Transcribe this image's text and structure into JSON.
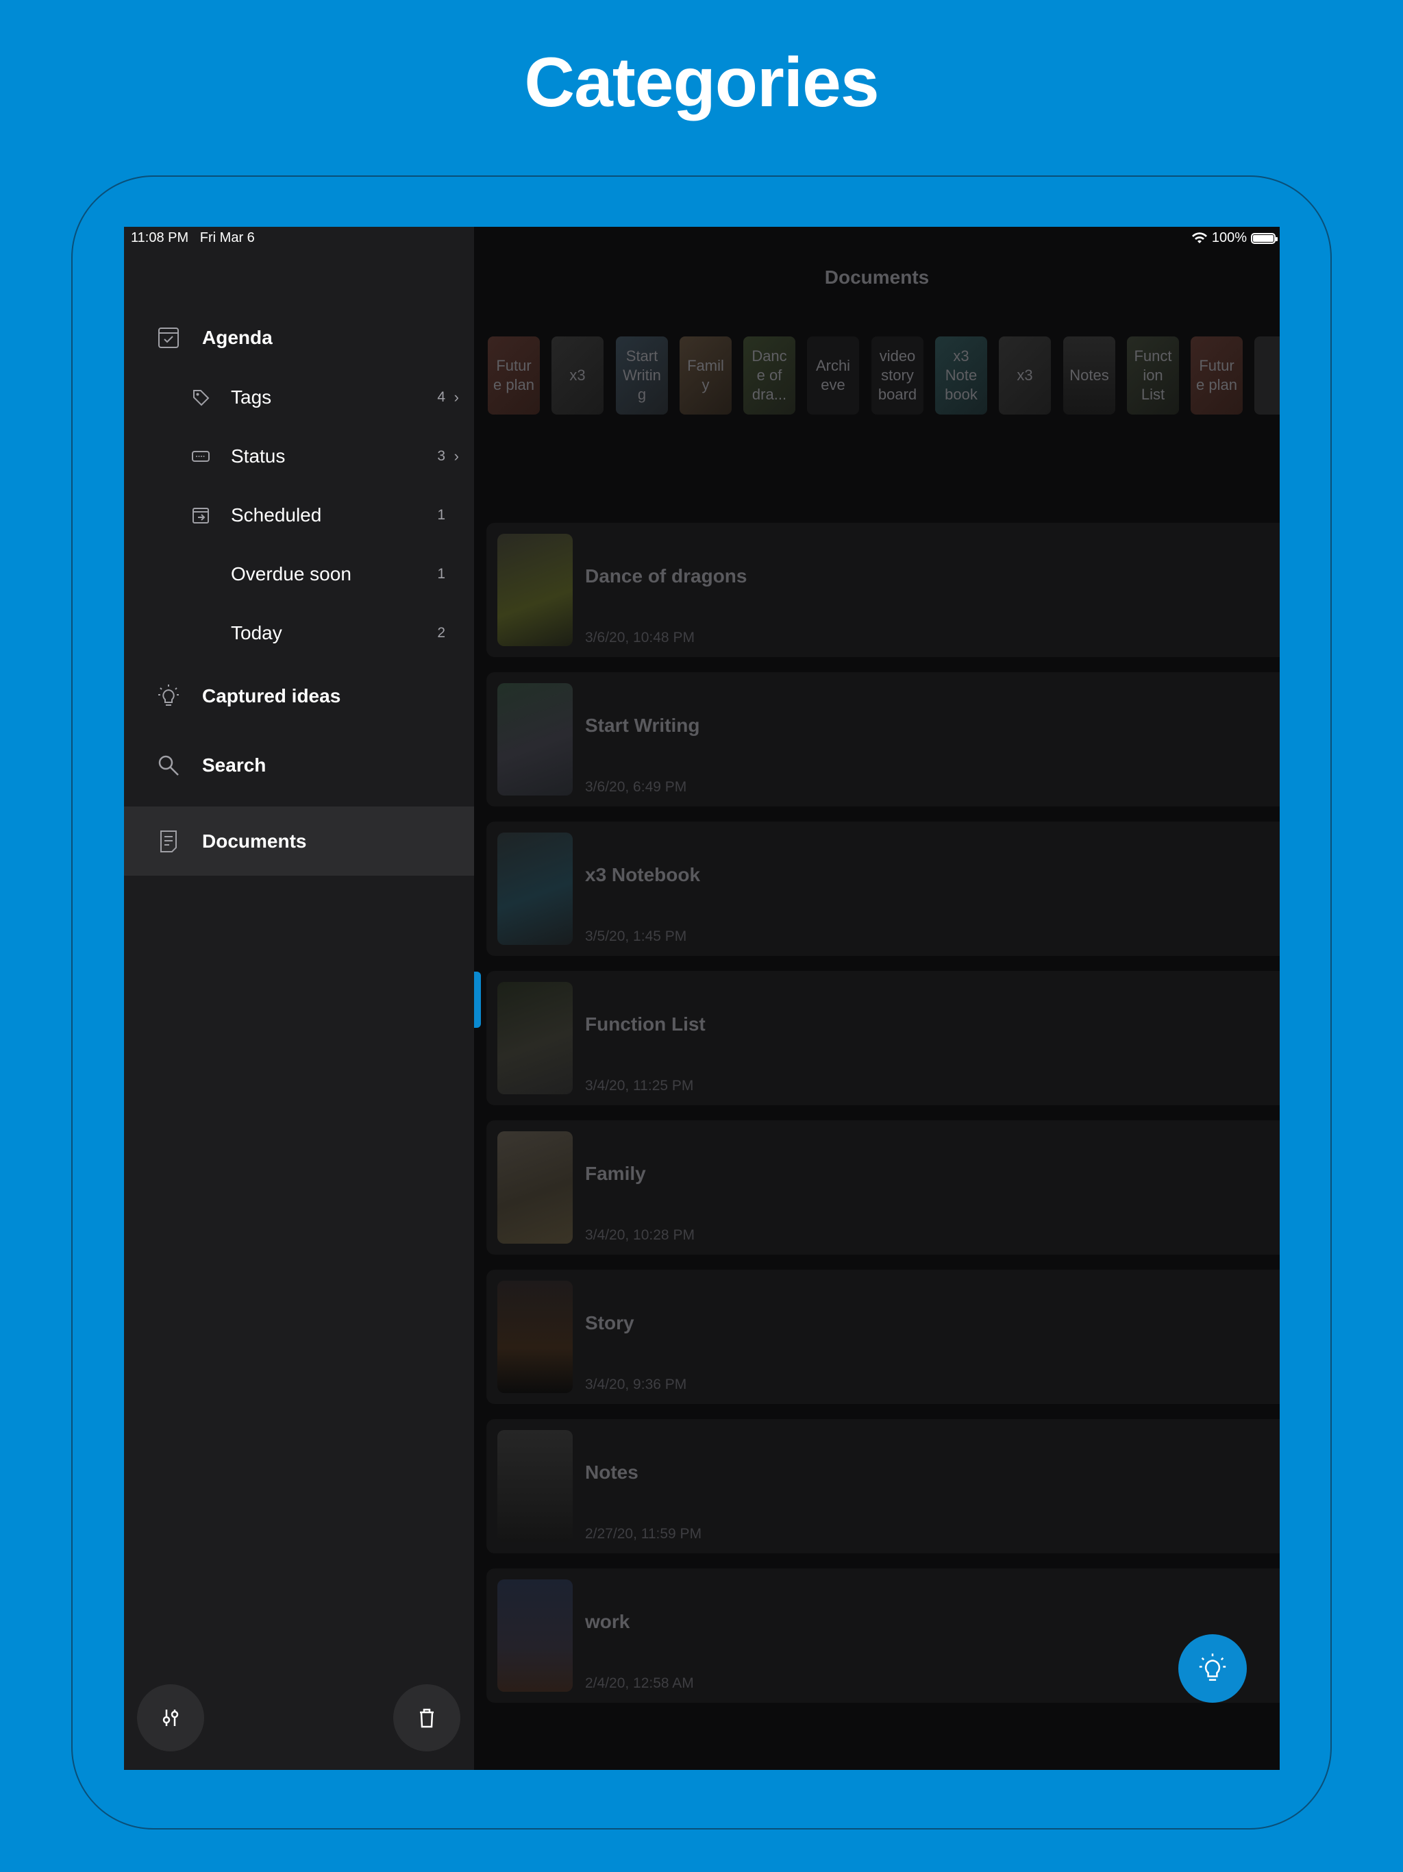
{
  "headline": "Categories",
  "status_bar": {
    "time": "11:08 PM",
    "date": "Fri Mar 6",
    "battery": "100%"
  },
  "sidebar": {
    "agenda": "Agenda",
    "tags": {
      "label": "Tags",
      "count": "4"
    },
    "status": {
      "label": "Status",
      "count": "3"
    },
    "scheduled": {
      "label": "Scheduled",
      "count": "1"
    },
    "overdue": {
      "label": "Overdue soon",
      "count": "1"
    },
    "today": {
      "label": "Today",
      "count": "2"
    },
    "captured": "Captured ideas",
    "search": "Search",
    "documents": "Documents"
  },
  "main": {
    "title": "Documents",
    "strip": [
      "Futur e plan",
      "x3",
      "Start Writin g",
      "Famil y",
      "Danc e of dra...",
      "Archi eve",
      "video story board",
      "x3 Note book",
      "x3",
      "Notes",
      "Funct ion List",
      "Futur e plan",
      ""
    ],
    "documents": [
      {
        "name": "Dance of dragons",
        "date": "3/6/20, 10:48 PM"
      },
      {
        "name": "Start Writing",
        "date": "3/6/20, 6:49 PM"
      },
      {
        "name": "x3 Notebook",
        "date": "3/5/20, 1:45 PM"
      },
      {
        "name": "Function List",
        "date": "3/4/20, 11:25 PM"
      },
      {
        "name": "Family",
        "date": "3/4/20, 10:28 PM"
      },
      {
        "name": "Story",
        "date": "3/4/20, 9:36 PM"
      },
      {
        "name": "Notes",
        "date": "2/27/20, 11:59 PM"
      },
      {
        "name": "work",
        "date": "2/4/20, 12:58 AM"
      }
    ]
  },
  "colors": {
    "background": "#008bd5",
    "accent": "#0a8ad1",
    "sidebar": "#1c1c1e",
    "selected": "#2c2c2e"
  }
}
